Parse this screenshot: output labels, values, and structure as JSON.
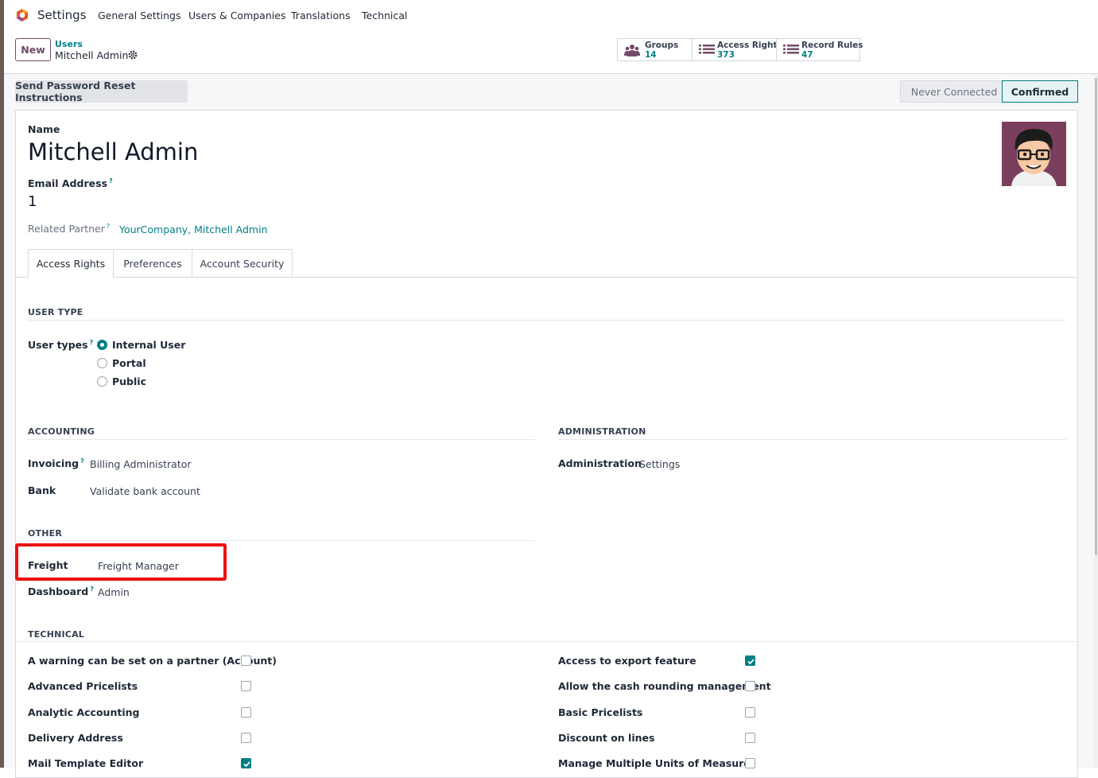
{
  "nav": {
    "app_name": "Settings",
    "items": [
      "General Settings",
      "Users & Companies",
      "Translations",
      "Technical"
    ]
  },
  "control": {
    "new_label": "New",
    "breadcrumb_parent": "Users",
    "breadcrumb_current": "Mitchell Admin"
  },
  "smart_buttons": [
    {
      "label": "Groups",
      "count": "14",
      "icon": "users-icon"
    },
    {
      "label": "Access Rights",
      "count": "373",
      "icon": "list-icon"
    },
    {
      "label": "Record Rules",
      "count": "47",
      "icon": "list-icon"
    }
  ],
  "header": {
    "reset_label": "Send Password Reset Instructions",
    "status": [
      "Never Connected",
      "Confirmed"
    ],
    "status_active": "Confirmed"
  },
  "form": {
    "name_label": "Name",
    "name_value": "Mitchell Admin",
    "email_label": "Email Address",
    "email_value": "1",
    "partner_label": "Related Partner",
    "partner_value": "YourCompany, Mitchell Admin"
  },
  "tabs": [
    "Access Rights",
    "Preferences",
    "Account Security"
  ],
  "user_type": {
    "section": "USER TYPE",
    "label": "User types",
    "options": [
      "Internal User",
      "Portal",
      "Public"
    ],
    "selected": "Internal User"
  },
  "accounting": {
    "section": "ACCOUNTING",
    "rows": [
      {
        "label": "Invoicing",
        "value": "Billing Administrator"
      },
      {
        "label": "Bank",
        "value": "Validate bank account"
      }
    ]
  },
  "administration": {
    "section": "ADMINISTRATION",
    "label": "Administration",
    "value": "Settings"
  },
  "other": {
    "section": "OTHER",
    "rows": [
      {
        "label": "Freight",
        "value": "Freight Manager"
      },
      {
        "label": "Dashboard",
        "value": "Admin"
      }
    ]
  },
  "technical": {
    "section": "TECHNICAL",
    "left": [
      {
        "label": "A warning can be set on a partner (Account)",
        "checked": false
      },
      {
        "label": "Advanced Pricelists",
        "checked": false
      },
      {
        "label": "Analytic Accounting",
        "checked": false
      },
      {
        "label": "Delivery Address",
        "checked": false
      },
      {
        "label": "Mail Template Editor",
        "checked": true
      }
    ],
    "right": [
      {
        "label": "Access to export feature",
        "checked": true
      },
      {
        "label": "Allow the cash rounding management",
        "checked": false
      },
      {
        "label": "Basic Pricelists",
        "checked": false
      },
      {
        "label": "Discount on lines",
        "checked": false
      },
      {
        "label": "Manage Multiple Units of Measure",
        "checked": false
      }
    ]
  },
  "colors": {
    "brand": "#714B67",
    "accent": "#017e84",
    "highlight": "#ee1111"
  }
}
